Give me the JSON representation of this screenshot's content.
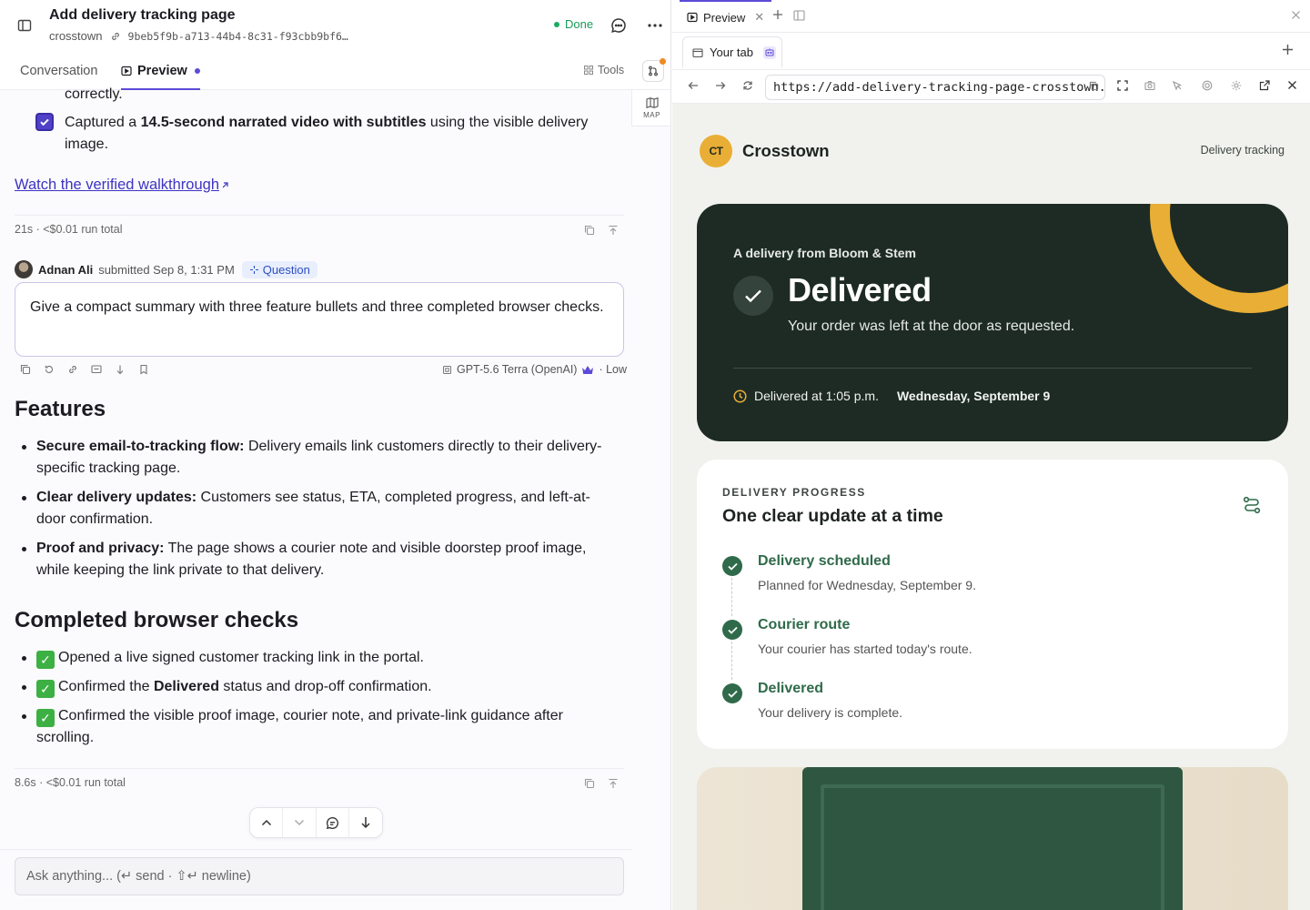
{
  "task": {
    "title": "Add delivery tracking page",
    "repo": "crosstown",
    "hash": "9beb5f9b-a713-44b4-8c31-f93cbb9bf6…",
    "status": "Done"
  },
  "tabs": {
    "conversation": "Conversation",
    "preview": "Preview",
    "tools": "Tools",
    "map": "MAP"
  },
  "conversation": {
    "prev_tail": "correctly.",
    "checkbox_item": {
      "prefix": "Captured a ",
      "bold": "14.5-second narrated video with subtitles",
      "suffix": " using the visible delivery image."
    },
    "walkthrough_link": "Watch the verified walkthrough",
    "run_meta_1": "21s · <$0.01 run total",
    "user": {
      "name": "Adnan Ali",
      "submitted": "submitted Sep 8, 1:31 PM",
      "badge": "Question"
    },
    "prompt": "Give a compact summary with three feature bullets and three completed browser checks.",
    "model": "GPT-5.6 Terra (OpenAI)",
    "effort": "· Low",
    "features_heading": "Features",
    "features": [
      {
        "bold": "Secure email-to-tracking flow:",
        "text": " Delivery emails link customers directly to their delivery-specific tracking page."
      },
      {
        "bold": "Clear delivery updates:",
        "text": " Customers see status, ETA, completed progress, and left-at-door confirmation."
      },
      {
        "bold": "Proof and privacy:",
        "text": " The page shows a courier note and visible doorstep proof image, while keeping the link private to that delivery."
      }
    ],
    "checks_heading": "Completed browser checks",
    "checks": [
      {
        "pre": "Opened a live signed customer tracking link in the portal.",
        "bold": "",
        "post": ""
      },
      {
        "pre": "Confirmed the ",
        "bold": "Delivered",
        "post": " status and drop-off confirmation."
      },
      {
        "pre": "Confirmed the visible proof image, courier note, and private-link guidance after scrolling.",
        "bold": "",
        "post": ""
      }
    ],
    "run_meta_2": "8.6s · <$0.01 run total",
    "ask_placeholder": "Ask anything... (↵ send · ⇧↵ newline)"
  },
  "browser": {
    "panel_tab": "Preview",
    "tab_label": "Your tab",
    "url": "https://add-delivery-tracking-page-crosstown.example"
  },
  "site": {
    "logo": "CT",
    "brand": "Crosstown",
    "header_link": "Delivery tracking",
    "hero": {
      "from": "A delivery from Bloom & Stem",
      "status": "Delivered",
      "sub": "Your order was left at the door as requested.",
      "time": "Delivered at 1:05 p.m.",
      "date": "Wednesday, September 9"
    },
    "progress": {
      "eyebrow": "DELIVERY PROGRESS",
      "title": "One clear update at a time",
      "steps": [
        {
          "title": "Delivery scheduled",
          "desc": "Planned for Wednesday, September 9."
        },
        {
          "title": "Courier route",
          "desc": "Your courier has started today's route."
        },
        {
          "title": "Delivered",
          "desc": "Your delivery is complete."
        }
      ]
    }
  },
  "colors": {
    "accent": "#5b4bd6",
    "hero_bg": "#1d2b24",
    "ring": "#e9ae35",
    "step_green": "#2f6a4a"
  }
}
